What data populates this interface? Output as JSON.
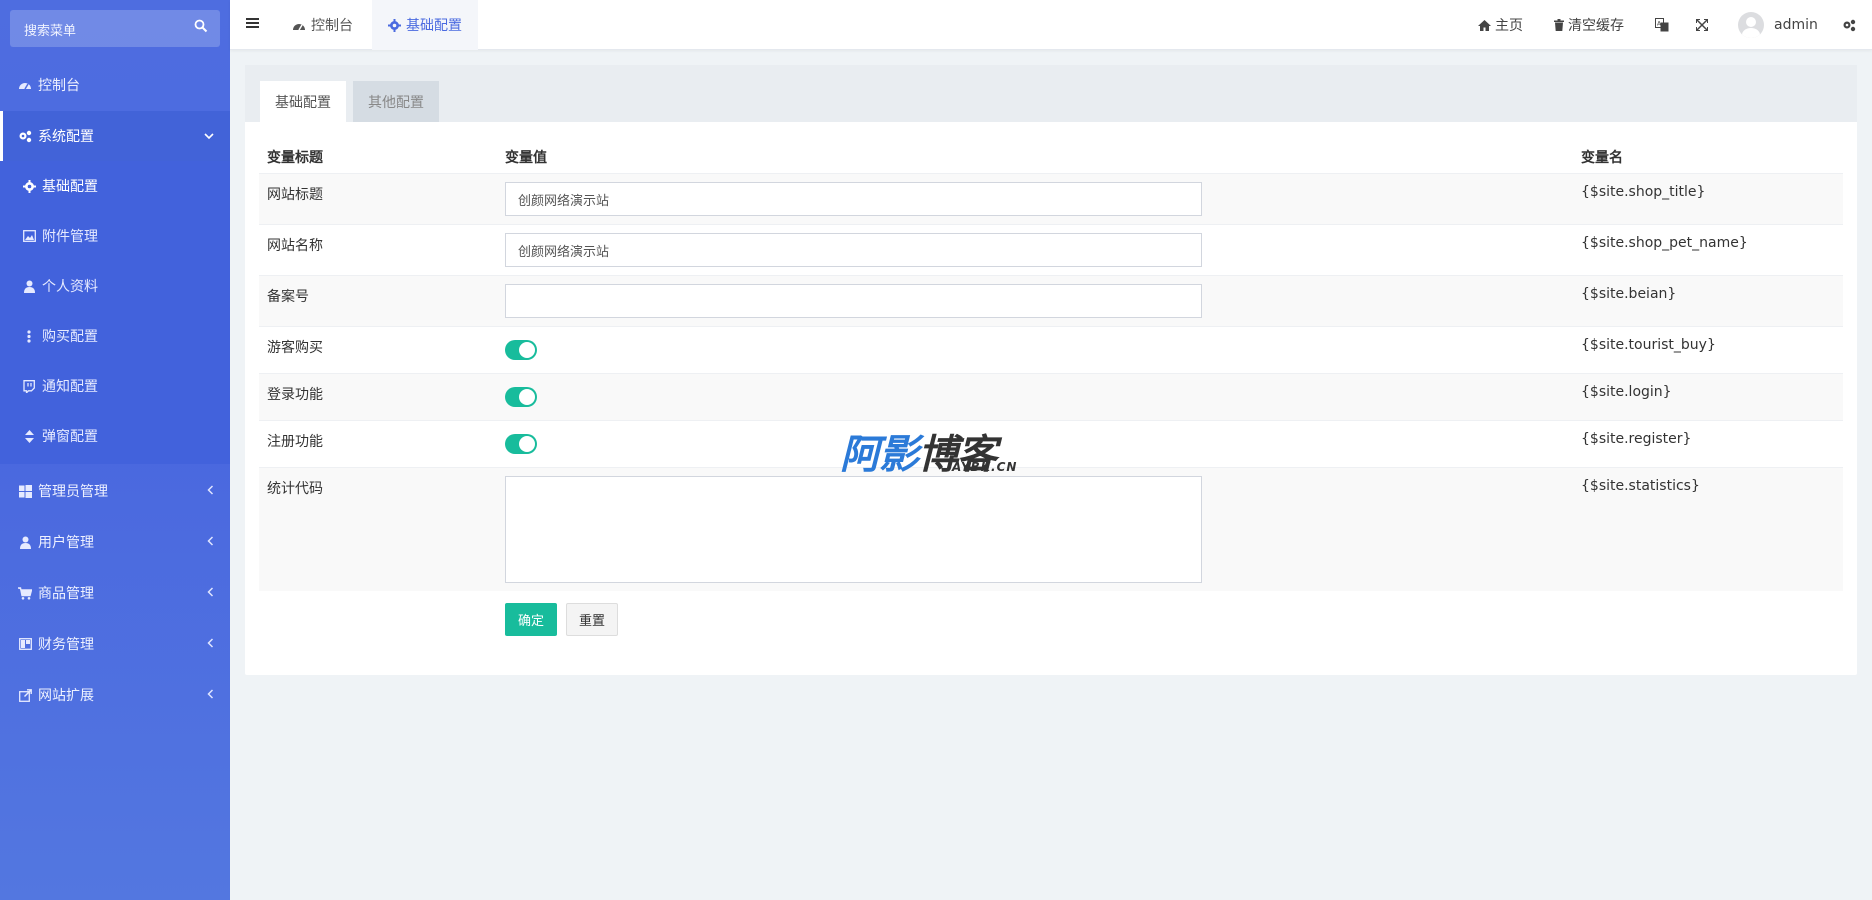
{
  "colors": {
    "sidebar": "#4e6de0",
    "accent": "#4a6ae0",
    "success": "#18bc9c",
    "background": "#eff3f6"
  },
  "sidebar": {
    "search_placeholder": "搜索菜单",
    "items": [
      {
        "label": "控制台",
        "icon": "dashboard-icon"
      },
      {
        "label": "系统配置",
        "icon": "gears-icon",
        "expanded": true
      },
      {
        "label": "管理员管理",
        "icon": "windows-icon"
      },
      {
        "label": "用户管理",
        "icon": "user-icon"
      },
      {
        "label": "商品管理",
        "icon": "cart-icon"
      },
      {
        "label": "财务管理",
        "icon": "columns-icon"
      },
      {
        "label": "网站扩展",
        "icon": "external-link-icon"
      }
    ],
    "subitems": [
      {
        "label": "基础配置",
        "icon": "gear-icon"
      },
      {
        "label": "附件管理",
        "icon": "image-icon"
      },
      {
        "label": "个人资料",
        "icon": "user-icon"
      },
      {
        "label": "购买配置",
        "icon": "ellipsis-v-icon"
      },
      {
        "label": "通知配置",
        "icon": "twitch-icon"
      },
      {
        "label": "弹窗配置",
        "icon": "sort-icon"
      }
    ]
  },
  "header": {
    "tabs": [
      {
        "label": "控制台",
        "icon": "dashboard-icon"
      },
      {
        "label": "基础配置",
        "icon": "gear-icon"
      }
    ],
    "home": "主页",
    "clear_cache": "清空缓存",
    "user": "admin"
  },
  "panel": {
    "tabs": [
      "基础配置",
      "其他配置"
    ],
    "columns": [
      "变量标题",
      "变量值",
      "变量名"
    ],
    "rows": [
      {
        "title": "网站标题",
        "type": "input",
        "value": "创颜网络演示站",
        "var": "{$site.shop_title}"
      },
      {
        "title": "网站名称",
        "type": "input",
        "value": "创颜网络演示站",
        "var": "{$site.shop_pet_name}"
      },
      {
        "title": "备案号",
        "type": "input",
        "value": "",
        "var": "{$site.beian}"
      },
      {
        "title": "游客购买",
        "type": "switch",
        "on": true,
        "var": "{$site.tourist_buy}"
      },
      {
        "title": "登录功能",
        "type": "switch",
        "on": true,
        "var": "{$site.login}"
      },
      {
        "title": "注册功能",
        "type": "switch",
        "on": true,
        "var": "{$site.register}"
      },
      {
        "title": "统计代码",
        "type": "textarea",
        "value": "",
        "var": "{$site.statistics}"
      }
    ],
    "submit": "确定",
    "reset": "重置"
  },
  "watermark": {
    "text": "阿影博客",
    "sub": "AYBK.CN"
  }
}
